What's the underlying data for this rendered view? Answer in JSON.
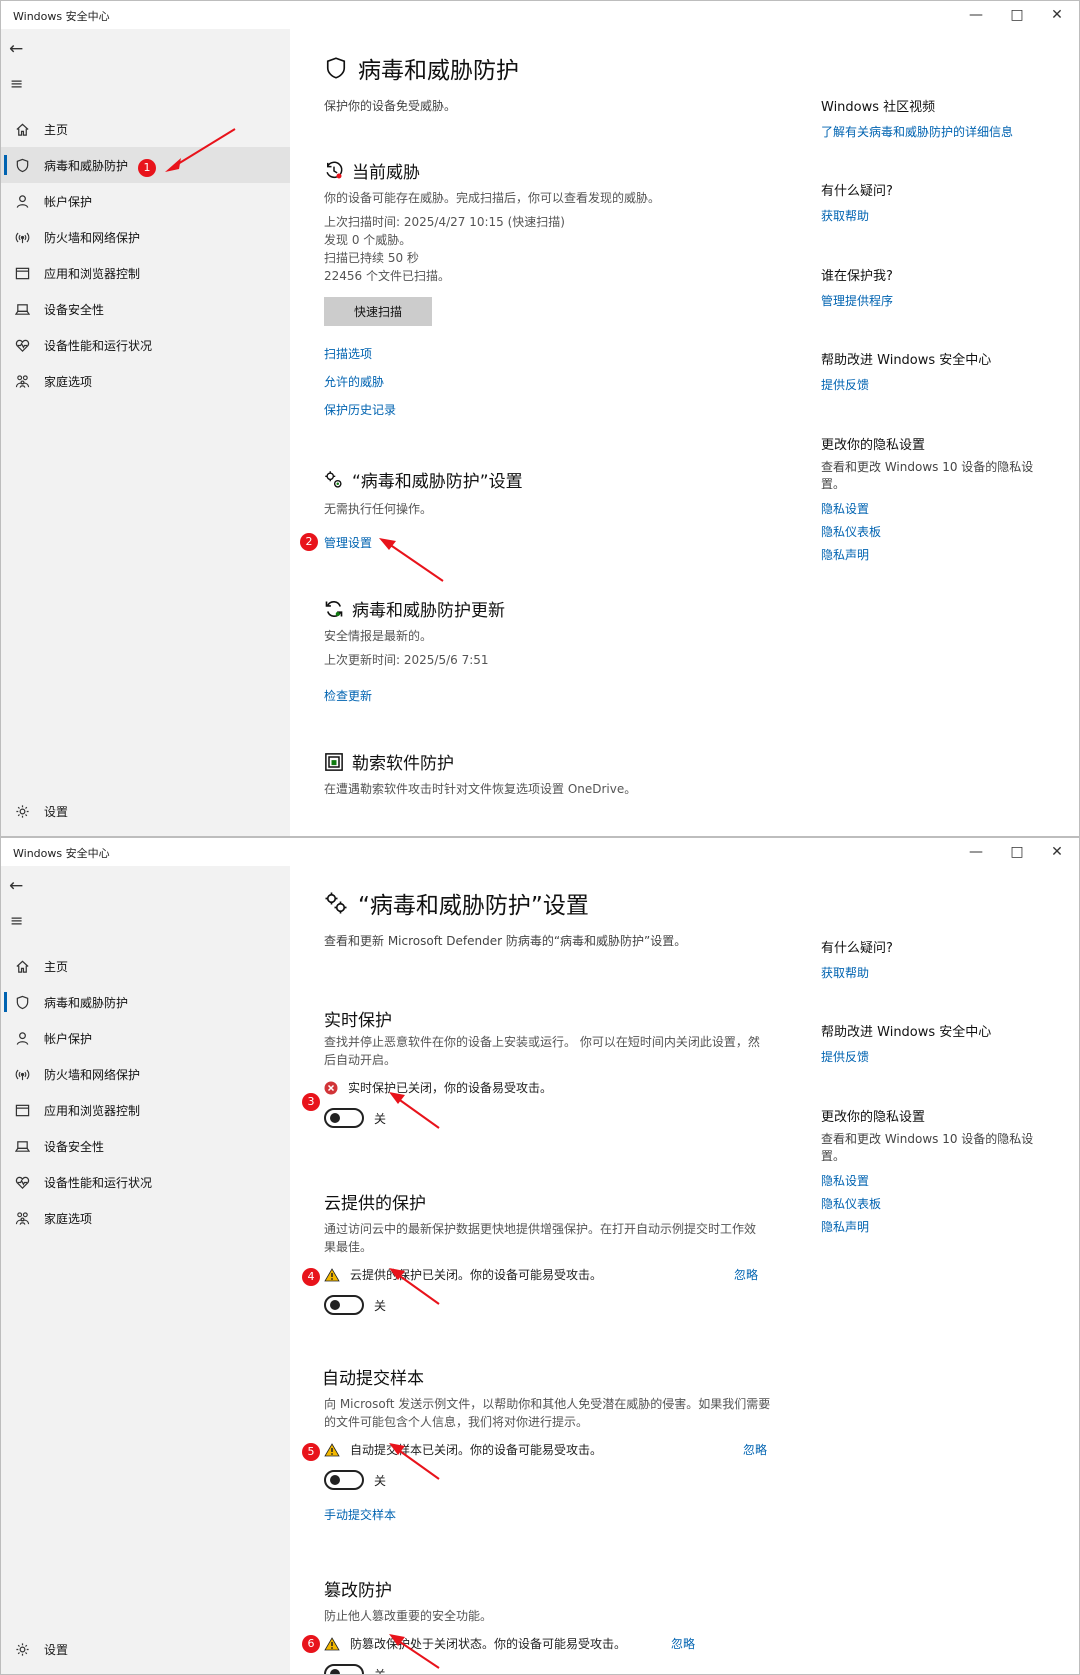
{
  "colors": {
    "accent": "#0063b1",
    "badge": "#e8131b",
    "sidebar_bg": "#f2f2f2",
    "warning": "#f3b800",
    "error": "#d13438"
  },
  "window1": {
    "app_title": "Windows 安全中心",
    "nav": [
      {
        "label": "主页",
        "icon": "home-icon"
      },
      {
        "label": "病毒和威胁防护",
        "icon": "shield-icon"
      },
      {
        "label": "帐户保护",
        "icon": "person-icon"
      },
      {
        "label": "防火墙和网络保护",
        "icon": "wifi-icon"
      },
      {
        "label": "应用和浏览器控制",
        "icon": "browser-window-icon"
      },
      {
        "label": "设备安全性",
        "icon": "laptop-icon"
      },
      {
        "label": "设备性能和运行状况",
        "icon": "heart-icon"
      },
      {
        "label": "家庭选项",
        "icon": "family-icon"
      }
    ],
    "settings_label": "设置",
    "page_title": "病毒和威胁防护",
    "page_subtitle": "保护你的设备免受威胁。",
    "current_threats": {
      "title": "当前威胁",
      "desc": "你的设备可能存在威胁。完成扫描后，你可以查看发现的威胁。",
      "last_scan": "上次扫描时间: 2025/4/27 10:15 (快速扫描)",
      "found": "发现 0 个威胁。",
      "duration": "扫描已持续 50 秒",
      "files": "22456 个文件已扫描。",
      "quick_scan_btn": "快速扫描",
      "links": [
        "扫描选项",
        "允许的威胁",
        "保护历史记录"
      ]
    },
    "vtp_settings": {
      "title": "“病毒和威胁防护”设置",
      "desc": "无需执行任何操作。",
      "manage_link": "管理设置"
    },
    "updates": {
      "title": "病毒和威胁防护更新",
      "desc": "安全情报是最新的。",
      "last_update": "上次更新时间: 2025/5/6 7:51",
      "check_link": "检查更新"
    },
    "ransomware": {
      "title": "勒索软件防护",
      "desc": "在遭遇勒索软件攻击时针对文件恢复选项设置 OneDrive。"
    },
    "side": {
      "community": {
        "title": "Windows 社区视频",
        "link": "了解有关病毒和威胁防护的详细信息"
      },
      "questions": {
        "title": "有什么疑问?",
        "link": "获取帮助"
      },
      "who": {
        "title": "谁在保护我?",
        "link": "管理提供程序"
      },
      "improve": {
        "title": "帮助改进 Windows 安全中心",
        "link": "提供反馈"
      },
      "privacy": {
        "title": "更改你的隐私设置",
        "desc": "查看和更改 Windows 10 设备的隐私设置。",
        "links": [
          "隐私设置",
          "隐私仪表板",
          "隐私声明"
        ]
      }
    },
    "badges": [
      "1",
      "2"
    ]
  },
  "window2": {
    "app_title": "Windows 安全中心",
    "page_title": "“病毒和威胁防护”设置",
    "page_subtitle": "查看和更新 Microsoft Defender 防病毒的“病毒和威胁防护”设置。",
    "realtime": {
      "title": "实时保护",
      "desc": "查找并停止恶意软件在你的设备上安装或运行。 你可以在短时间内关闭此设置，然后自动开启。",
      "status": "实时保护已关闭，你的设备易受攻击。",
      "toggle": "关"
    },
    "cloud": {
      "title": "云提供的保护",
      "desc": "通过访问云中的最新保护数据更快地提供增强保护。在打开自动示例提交时工作效果最佳。",
      "status": "云提供的保护已关闭。你的设备可能易受攻击。",
      "dismiss": "忽略",
      "toggle": "关"
    },
    "sample": {
      "title": "自动提交样本",
      "desc": "向 Microsoft 发送示例文件，以帮助你和其他人免受潜在威胁的侵害。如果我们需要的文件可能包含个人信息，我们将对你进行提示。",
      "status": "自动提交样本已关闭。你的设备可能易受攻击。",
      "dismiss": "忽略",
      "toggle": "关",
      "manual_link": "手动提交样本"
    },
    "tamper": {
      "title": "篡改防护",
      "desc": "防止他人篡改重要的安全功能。",
      "status": "防篡改保护处于关闭状态。你的设备可能易受攻击。",
      "dismiss": "忽略",
      "toggle": "关"
    },
    "side": {
      "questions": {
        "title": "有什么疑问?",
        "link": "获取帮助"
      },
      "improve": {
        "title": "帮助改进 Windows 安全中心",
        "link": "提供反馈"
      },
      "privacy": {
        "title": "更改你的隐私设置",
        "desc": "查看和更改 Windows 10 设备的隐私设置。",
        "links": [
          "隐私设置",
          "隐私仪表板",
          "隐私声明"
        ]
      }
    },
    "badges": [
      "3",
      "4",
      "5",
      "6"
    ]
  }
}
